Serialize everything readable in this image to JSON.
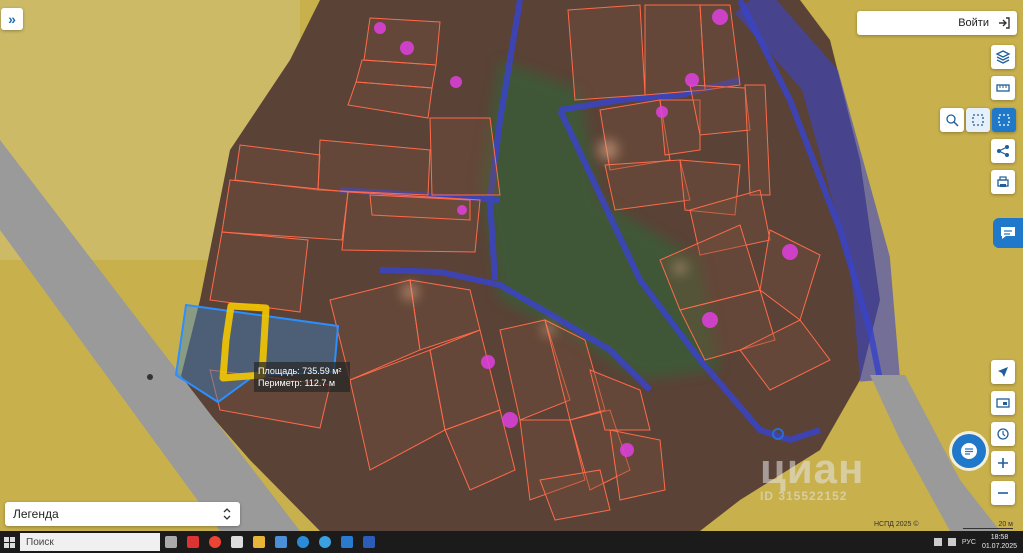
{
  "header": {
    "login_label": "Войти"
  },
  "measure": {
    "area_label": "Площадь: 735.59 м²",
    "perimeter_label": "Периметр: 112.7 м"
  },
  "legend": {
    "label": "Легенда"
  },
  "footer": {
    "copyright": "НСПД 2025 ©",
    "scale": "20 м"
  },
  "watermark": "циан",
  "watermark_id": "ID 315522152",
  "taskbar": {
    "search_placeholder": "Поиск",
    "language": "РУС",
    "time": "18:58",
    "date": "01.07.2025"
  },
  "colors": {
    "field": "#c9b14a",
    "road": "#9a9a9a",
    "parcel_border": "#ff6a4a",
    "selection": "#2b8fff",
    "measure_outline": "#f5c800",
    "accent": "#1f78c9"
  },
  "icons": {
    "expand": "double-chevron-right-icon",
    "login": "login-arrow-icon",
    "layers": "layers-icon",
    "ruler": "ruler-icon",
    "search_area": "zoom-area-icon",
    "select": "select-area-icon",
    "select_alt": "select-area-alt-icon",
    "share": "share-icon",
    "print": "print-icon",
    "location": "location-arrow-icon",
    "card": "card-icon",
    "history": "history-icon",
    "zoom_in": "plus-icon",
    "zoom_out": "minus-icon",
    "chat": "chat-icon"
  }
}
